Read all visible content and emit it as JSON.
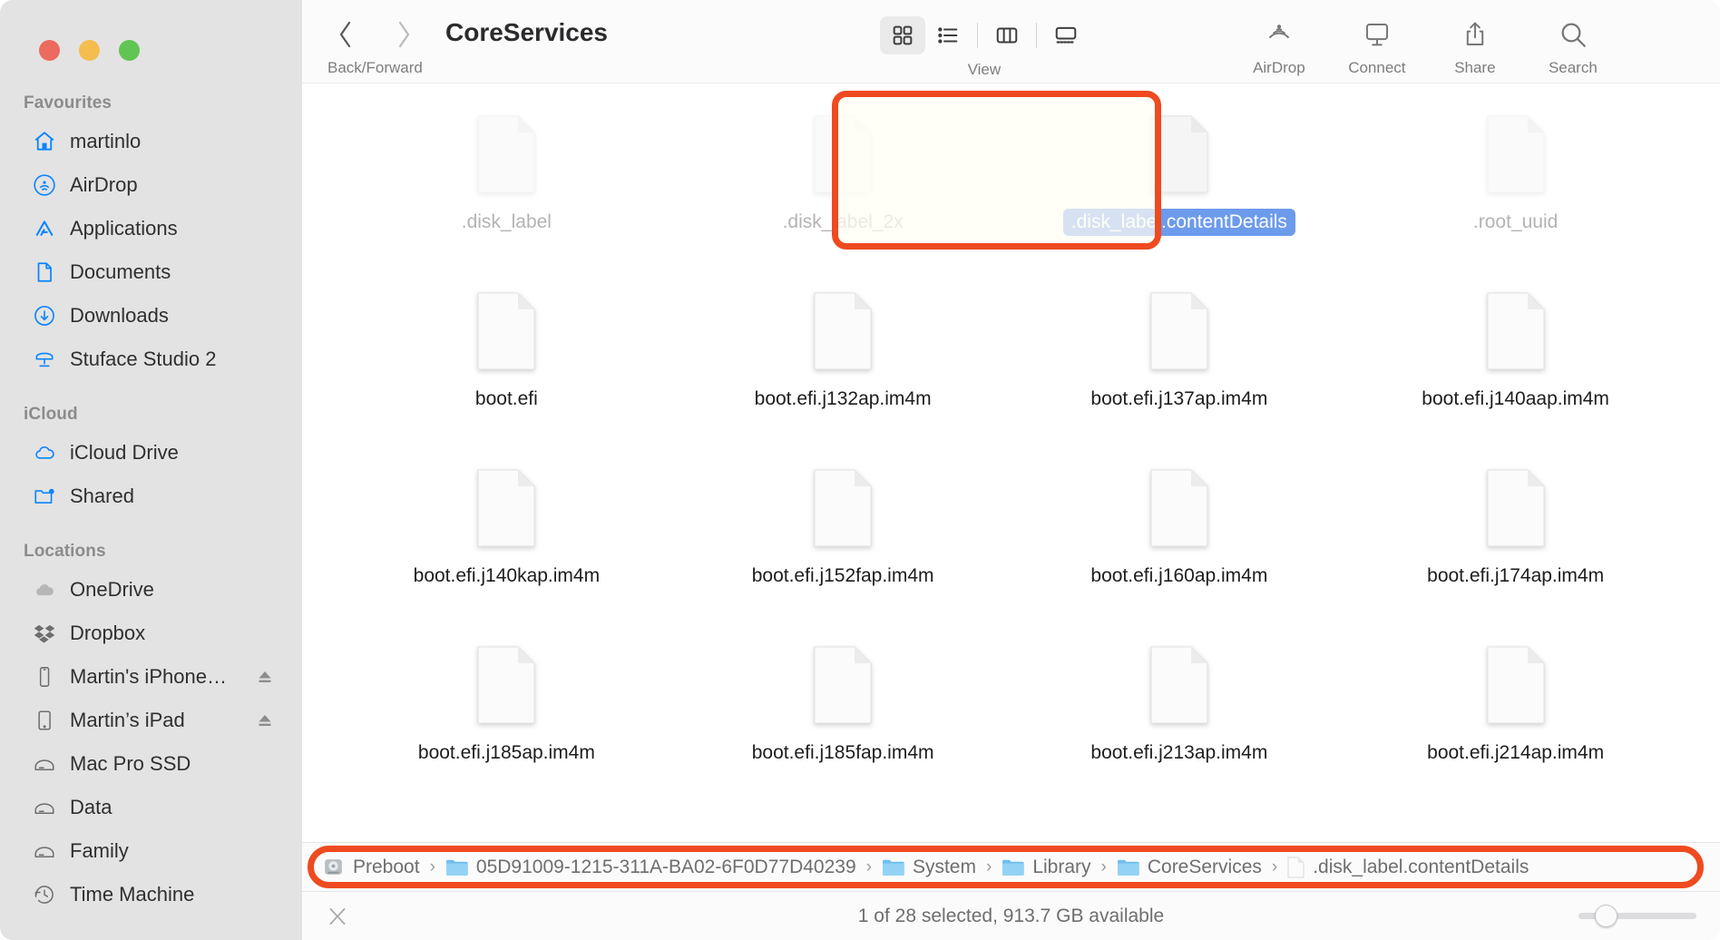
{
  "window": {
    "title": "CoreServices",
    "traffic_lights": [
      {
        "name": "close",
        "color": "#ec6a5e"
      },
      {
        "name": "minimize",
        "color": "#f5bd4f"
      },
      {
        "name": "zoom",
        "color": "#61c554"
      }
    ]
  },
  "sidebar": {
    "groups": [
      {
        "header": "Favourites",
        "items": [
          {
            "label": "martinlo",
            "icon": "home-icon",
            "color": "#0a84ff",
            "eject": false
          },
          {
            "label": "AirDrop",
            "icon": "airdrop-icon",
            "color": "#0a84ff",
            "eject": false
          },
          {
            "label": "Applications",
            "icon": "applications-icon",
            "color": "#0a84ff",
            "eject": false
          },
          {
            "label": "Documents",
            "icon": "documents-icon",
            "color": "#0a84ff",
            "eject": false
          },
          {
            "label": "Downloads",
            "icon": "downloads-icon",
            "color": "#0a84ff",
            "eject": false
          },
          {
            "label": "Stuface Studio 2",
            "icon": "server-icon",
            "color": "#0a84ff",
            "eject": false
          }
        ]
      },
      {
        "header": "iCloud",
        "items": [
          {
            "label": "iCloud Drive",
            "icon": "cloud-icon",
            "color": "#0a84ff",
            "eject": false
          },
          {
            "label": "Shared",
            "icon": "shared-folder-icon",
            "color": "#0a84ff",
            "eject": false
          }
        ]
      },
      {
        "header": "Locations",
        "items": [
          {
            "label": "OneDrive",
            "icon": "onedrive-cloud-icon",
            "color": "#9a9a9c",
            "eject": false
          },
          {
            "label": "Dropbox",
            "icon": "dropbox-icon",
            "color": "#6e6e70",
            "eject": false
          },
          {
            "label": "Martin's iPhone…",
            "icon": "iphone-icon",
            "color": "#6e6e70",
            "eject": true
          },
          {
            "label": "Martin’s iPad",
            "icon": "ipad-icon",
            "color": "#6e6e70",
            "eject": true
          },
          {
            "label": "Mac Pro SSD",
            "icon": "harddisk-icon",
            "color": "#6e6e70",
            "eject": false
          },
          {
            "label": "Data",
            "icon": "harddisk-icon",
            "color": "#6e6e70",
            "eject": false
          },
          {
            "label": "Family",
            "icon": "harddisk-icon",
            "color": "#6e6e70",
            "eject": false
          },
          {
            "label": "Time Machine",
            "icon": "time-machine-icon",
            "color": "#6e6e70",
            "eject": false
          }
        ]
      }
    ]
  },
  "toolbar": {
    "nav_caption": "Back/Forward",
    "back_icon": "chevron-left-icon",
    "forward_icon": "chevron-right-icon",
    "title": "CoreServices",
    "view_caption": "View",
    "view_buttons": [
      {
        "name": "icon-view",
        "icon": "grid-icon",
        "active": true
      },
      {
        "name": "list-view",
        "icon": "list-icon",
        "active": false
      },
      {
        "name": "column-view",
        "icon": "columns-icon",
        "active": false
      },
      {
        "name": "gallery-view",
        "icon": "gallery-icon",
        "active": false
      }
    ],
    "actions": [
      {
        "label": "AirDrop",
        "icon": "airdrop-icon"
      },
      {
        "label": "Connect",
        "icon": "connect-display-icon"
      },
      {
        "label": "Share",
        "icon": "share-icon"
      },
      {
        "label": "Search",
        "icon": "search-icon"
      }
    ]
  },
  "files": [
    {
      "name": ".disk_label",
      "hidden": true,
      "selected": false
    },
    {
      "name": ".disk_label_2x",
      "hidden": true,
      "selected": false
    },
    {
      "name": ".disk_label.contentDetails",
      "hidden": true,
      "selected": true
    },
    {
      "name": ".root_uuid",
      "hidden": true,
      "selected": false
    },
    {
      "name": "boot.efi",
      "hidden": false,
      "selected": false
    },
    {
      "name": "boot.efi.j132ap.im4m",
      "hidden": false,
      "selected": false
    },
    {
      "name": "boot.efi.j137ap.im4m",
      "hidden": false,
      "selected": false
    },
    {
      "name": "boot.efi.j140aap.im4m",
      "hidden": false,
      "selected": false
    },
    {
      "name": "boot.efi.j140kap.im4m",
      "hidden": false,
      "selected": false
    },
    {
      "name": "boot.efi.j152fap.im4m",
      "hidden": false,
      "selected": false
    },
    {
      "name": "boot.efi.j160ap.im4m",
      "hidden": false,
      "selected": false
    },
    {
      "name": "boot.efi.j174ap.im4m",
      "hidden": false,
      "selected": false
    },
    {
      "name": "boot.efi.j185ap.im4m",
      "hidden": false,
      "selected": false
    },
    {
      "name": "boot.efi.j185fap.im4m",
      "hidden": false,
      "selected": false
    },
    {
      "name": "boot.efi.j213ap.im4m",
      "hidden": false,
      "selected": false
    },
    {
      "name": "boot.efi.j214ap.im4m",
      "hidden": false,
      "selected": false
    }
  ],
  "pathbar": {
    "separator": "›",
    "crumbs": [
      {
        "label": "Preboot",
        "icon": "harddisk-icon"
      },
      {
        "label": "05D91009-1215-311A-BA02-6F0D77D40239",
        "icon": "folder-icon"
      },
      {
        "label": "System",
        "icon": "folder-icon"
      },
      {
        "label": "Library",
        "icon": "folder-icon"
      },
      {
        "label": "CoreServices",
        "icon": "folder-icon"
      },
      {
        "label": ".disk_label.contentDetails",
        "icon": "file-icon"
      }
    ]
  },
  "statusbar": {
    "left_icon": "finder-tags-icon",
    "text": "1 of 28 selected, 913.7 GB available",
    "zoom_value": 18
  },
  "annotations": {
    "accent_color": "#ef4a20",
    "selection_color": "#6d9beb",
    "highlight_fill": "#fffdf4"
  }
}
